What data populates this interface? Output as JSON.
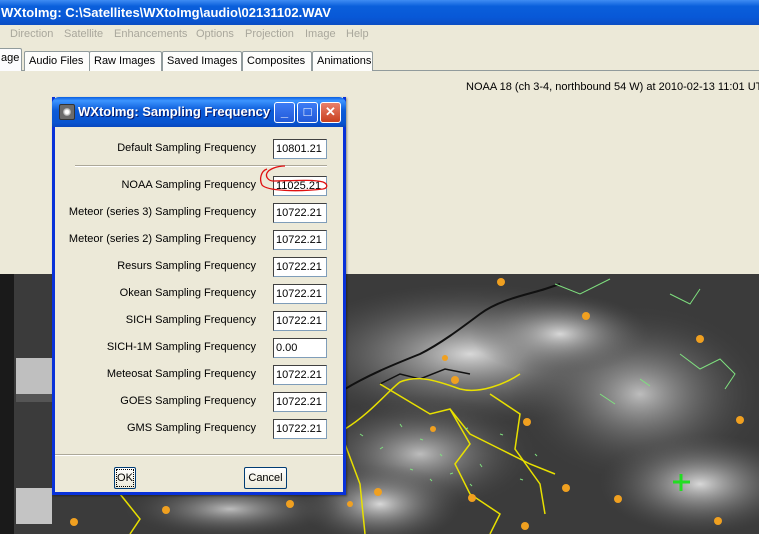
{
  "window": {
    "title": "WXtoImg: C:\\Satellites\\WXtoImg\\audio\\02131102.WAV"
  },
  "menubar": {
    "items": [
      "Direction",
      "Satellite",
      "Enhancements",
      "Options",
      "Projection",
      "Image",
      "Help"
    ]
  },
  "tabs": [
    "age",
    "Audio Files",
    "Raw Images",
    "Saved Images",
    "Composites",
    "Animations"
  ],
  "status_line": "NOAA 18 (ch 3-4, northbound 54 W) at 2010-02-13  11:01 UT",
  "dialog": {
    "title": "WXtoImg: Sampling Frequency",
    "fields": [
      {
        "label": "Default Sampling Frequency",
        "value": "10801.21"
      },
      {
        "label": "NOAA Sampling Frequency",
        "value": "11025.21"
      },
      {
        "label": "Meteor (series 3) Sampling Frequency",
        "value": "10722.21"
      },
      {
        "label": "Meteor (series 2) Sampling Frequency",
        "value": "10722.21"
      },
      {
        "label": "Resurs Sampling Frequency",
        "value": "10722.21"
      },
      {
        "label": "Okean Sampling Frequency",
        "value": "10722.21"
      },
      {
        "label": "SICH Sampling Frequency",
        "value": "10722.21"
      },
      {
        "label": "SICH-1M Sampling Frequency",
        "value": "0.00"
      },
      {
        "label": "Meteosat Sampling Frequency",
        "value": "10722.21"
      },
      {
        "label": "GOES Sampling Frequency",
        "value": "10722.21"
      },
      {
        "label": "GMS Sampling Frequency",
        "value": "10722.21"
      }
    ],
    "ok_label": "OK",
    "cancel_label": "Cancel"
  },
  "colors": {
    "title_blue": "#0a5fdb",
    "annotation_red": "#e01010",
    "coast_yellow": "#e8e000",
    "border_green": "#7fe07f",
    "city_orange": "#f0a020",
    "cursor_green": "#22dd22"
  },
  "icons": [
    "app-icon",
    "minimize-icon",
    "maximize-icon",
    "close-icon",
    "crosshair-icon"
  ]
}
